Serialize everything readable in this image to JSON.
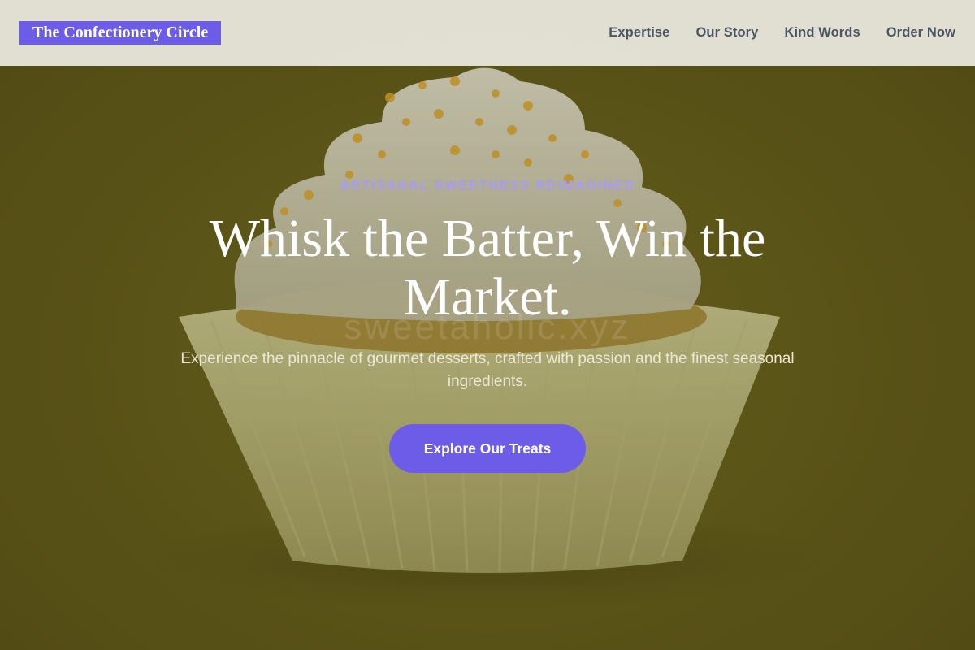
{
  "header": {
    "brand": "The Confectionery Circle",
    "nav": [
      {
        "label": "Expertise"
      },
      {
        "label": "Our Story"
      },
      {
        "label": "Kind Words"
      },
      {
        "label": "Order Now"
      }
    ]
  },
  "hero": {
    "eyebrow": "ARTISANAL SWEETNESS REIMAGINED",
    "headline": "Whisk the Batter, Win the Market.",
    "subtext": "Experience the pinnacle of gourmet desserts, crafted with passion and the finest seasonal ingredients.",
    "cta_label": "Explore Our Treats",
    "watermark": "sweetaholic.xyz"
  },
  "colors": {
    "accent": "#6c5ce7",
    "eyebrow": "#a99bf5",
    "nav_text": "#4a5563",
    "background": "#5f581c"
  }
}
